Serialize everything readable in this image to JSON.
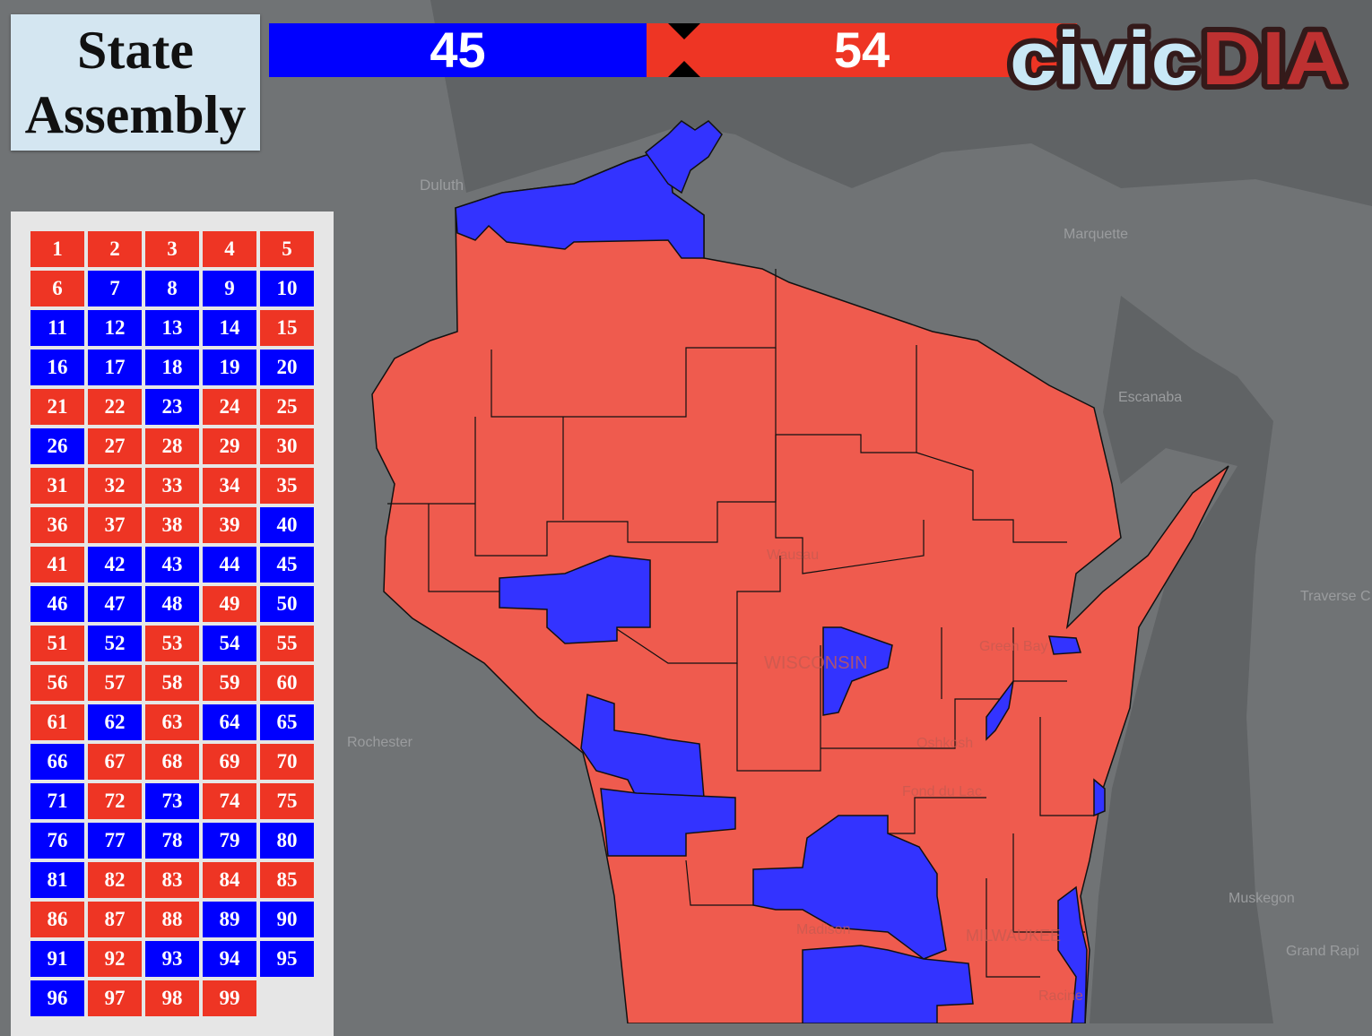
{
  "title": {
    "line1": "State",
    "line2": "Assembly"
  },
  "seat_bar": {
    "dem_seats": "45",
    "rep_seats": "54",
    "dem_color": "#0000ff",
    "rep_color": "#ee3524"
  },
  "logo": {
    "text": "civicDIA",
    "part1": "civic",
    "part2": "DIA"
  },
  "colors": {
    "dem": "#0000ff",
    "rep": "#ee3524",
    "map_dem": "#3333ff",
    "map_rep": "#ef5b4e"
  },
  "districts": [
    {
      "n": "1",
      "p": "R"
    },
    {
      "n": "2",
      "p": "R"
    },
    {
      "n": "3",
      "p": "R"
    },
    {
      "n": "4",
      "p": "R"
    },
    {
      "n": "5",
      "p": "R"
    },
    {
      "n": "6",
      "p": "R"
    },
    {
      "n": "7",
      "p": "D"
    },
    {
      "n": "8",
      "p": "D"
    },
    {
      "n": "9",
      "p": "D"
    },
    {
      "n": "10",
      "p": "D"
    },
    {
      "n": "11",
      "p": "D"
    },
    {
      "n": "12",
      "p": "D"
    },
    {
      "n": "13",
      "p": "D"
    },
    {
      "n": "14",
      "p": "D"
    },
    {
      "n": "15",
      "p": "R"
    },
    {
      "n": "16",
      "p": "D"
    },
    {
      "n": "17",
      "p": "D"
    },
    {
      "n": "18",
      "p": "D"
    },
    {
      "n": "19",
      "p": "D"
    },
    {
      "n": "20",
      "p": "D"
    },
    {
      "n": "21",
      "p": "R"
    },
    {
      "n": "22",
      "p": "R"
    },
    {
      "n": "23",
      "p": "D"
    },
    {
      "n": "24",
      "p": "R"
    },
    {
      "n": "25",
      "p": "R"
    },
    {
      "n": "26",
      "p": "D"
    },
    {
      "n": "27",
      "p": "R"
    },
    {
      "n": "28",
      "p": "R"
    },
    {
      "n": "29",
      "p": "R"
    },
    {
      "n": "30",
      "p": "R"
    },
    {
      "n": "31",
      "p": "R"
    },
    {
      "n": "32",
      "p": "R"
    },
    {
      "n": "33",
      "p": "R"
    },
    {
      "n": "34",
      "p": "R"
    },
    {
      "n": "35",
      "p": "R"
    },
    {
      "n": "36",
      "p": "R"
    },
    {
      "n": "37",
      "p": "R"
    },
    {
      "n": "38",
      "p": "R"
    },
    {
      "n": "39",
      "p": "R"
    },
    {
      "n": "40",
      "p": "D"
    },
    {
      "n": "41",
      "p": "R"
    },
    {
      "n": "42",
      "p": "D"
    },
    {
      "n": "43",
      "p": "D"
    },
    {
      "n": "44",
      "p": "D"
    },
    {
      "n": "45",
      "p": "D"
    },
    {
      "n": "46",
      "p": "D"
    },
    {
      "n": "47",
      "p": "D"
    },
    {
      "n": "48",
      "p": "D"
    },
    {
      "n": "49",
      "p": "R"
    },
    {
      "n": "50",
      "p": "D"
    },
    {
      "n": "51",
      "p": "R"
    },
    {
      "n": "52",
      "p": "D"
    },
    {
      "n": "53",
      "p": "R"
    },
    {
      "n": "54",
      "p": "D"
    },
    {
      "n": "55",
      "p": "R"
    },
    {
      "n": "56",
      "p": "R"
    },
    {
      "n": "57",
      "p": "R"
    },
    {
      "n": "58",
      "p": "R"
    },
    {
      "n": "59",
      "p": "R"
    },
    {
      "n": "60",
      "p": "R"
    },
    {
      "n": "61",
      "p": "R"
    },
    {
      "n": "62",
      "p": "D"
    },
    {
      "n": "63",
      "p": "R"
    },
    {
      "n": "64",
      "p": "D"
    },
    {
      "n": "65",
      "p": "D"
    },
    {
      "n": "66",
      "p": "D"
    },
    {
      "n": "67",
      "p": "R"
    },
    {
      "n": "68",
      "p": "R"
    },
    {
      "n": "69",
      "p": "R"
    },
    {
      "n": "70",
      "p": "R"
    },
    {
      "n": "71",
      "p": "D"
    },
    {
      "n": "72",
      "p": "R"
    },
    {
      "n": "73",
      "p": "D"
    },
    {
      "n": "74",
      "p": "R"
    },
    {
      "n": "75",
      "p": "R"
    },
    {
      "n": "76",
      "p": "D"
    },
    {
      "n": "77",
      "p": "D"
    },
    {
      "n": "78",
      "p": "D"
    },
    {
      "n": "79",
      "p": "D"
    },
    {
      "n": "80",
      "p": "D"
    },
    {
      "n": "81",
      "p": "D"
    },
    {
      "n": "82",
      "p": "R"
    },
    {
      "n": "83",
      "p": "R"
    },
    {
      "n": "84",
      "p": "R"
    },
    {
      "n": "85",
      "p": "R"
    },
    {
      "n": "86",
      "p": "R"
    },
    {
      "n": "87",
      "p": "R"
    },
    {
      "n": "88",
      "p": "R"
    },
    {
      "n": "89",
      "p": "D"
    },
    {
      "n": "90",
      "p": "D"
    },
    {
      "n": "91",
      "p": "D"
    },
    {
      "n": "92",
      "p": "R"
    },
    {
      "n": "93",
      "p": "D"
    },
    {
      "n": "94",
      "p": "D"
    },
    {
      "n": "95",
      "p": "D"
    },
    {
      "n": "96",
      "p": "D"
    },
    {
      "n": "97",
      "p": "R"
    },
    {
      "n": "98",
      "p": "R"
    },
    {
      "n": "99",
      "p": "R"
    }
  ],
  "map_labels": {
    "duluth": "Duluth",
    "marquette": "Marquette",
    "escanaba": "Escanaba",
    "traverse": "Traverse C",
    "rochester": "Rochester",
    "muskegon": "Muskegon",
    "grand_rapids": "Grand Rapi",
    "wausau": "Wausau",
    "wisconsin": "WISCONSIN",
    "green_bay": "Green Bay",
    "oshkosh": "Oshkosh",
    "fond_du_lac": "Fond du Lac",
    "madison": "Madison",
    "milwaukee": "MILWAUKEE",
    "racine": "Racine"
  }
}
